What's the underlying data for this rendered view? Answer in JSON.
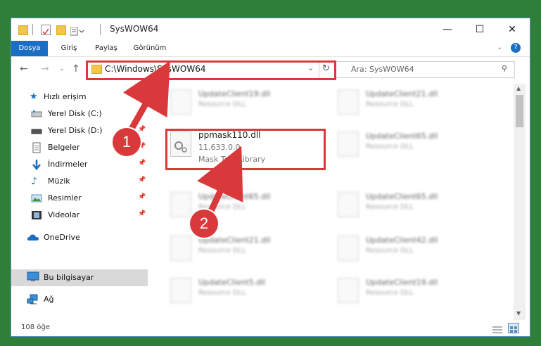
{
  "window": {
    "title": "SysWOW64"
  },
  "ribbon": {
    "tabs": [
      "Dosya",
      "Giriş",
      "Paylaş",
      "Görünüm"
    ]
  },
  "address": {
    "path": "C:\\Windows\\SysWOW64",
    "search_placeholder": "Ara: SysWOW64"
  },
  "sidebar": {
    "items": [
      {
        "label": "Hızlı erişim",
        "icon": "star-icon",
        "pinned": false
      },
      {
        "label": "Yerel Disk (C:)",
        "icon": "drive-icon",
        "pinned": false
      },
      {
        "label": "Yerel Disk (D:)",
        "icon": "drive-icon",
        "pinned": true
      },
      {
        "label": "Belgeler",
        "icon": "documents-icon",
        "pinned": true
      },
      {
        "label": "İndirmeler",
        "icon": "download-icon",
        "pinned": true
      },
      {
        "label": "Müzik",
        "icon": "music-icon",
        "pinned": true
      },
      {
        "label": "Resimler",
        "icon": "pictures-icon",
        "pinned": true
      },
      {
        "label": "Videolar",
        "icon": "videos-icon",
        "pinned": true
      },
      {
        "label": "OneDrive",
        "icon": "cloud-icon",
        "pinned": false
      },
      {
        "label": "Bu bilgisayar",
        "icon": "computer-icon",
        "pinned": false
      },
      {
        "label": "Ağ",
        "icon": "network-icon",
        "pinned": false
      }
    ]
  },
  "files": {
    "left": [
      {
        "name": "UpdateClient19.dll",
        "type": "Resource DLL"
      },
      {
        "name": "ppmask110.dll",
        "version": "11.633.0.0",
        "type": "Mask Tool Library"
      },
      {
        "name": "UpdateClient65.dll",
        "type": "Resource DLL"
      },
      {
        "name": "UpdateClient21.dll",
        "type": "Resource DLL"
      },
      {
        "name": "UpdateClient5.dll",
        "type": "Resource DLL"
      }
    ],
    "right": [
      {
        "name": "UpdateClient21.dll",
        "type": "Resource DLL"
      },
      {
        "name": "UpdateClient65.dll",
        "type": "Resource DLL"
      },
      {
        "name": "UpdateClient65.dll",
        "type": "Resource DLL"
      },
      {
        "name": "UpdateClient42.dll",
        "type": "Resource DLL"
      },
      {
        "name": "UpdateClient19.dll",
        "type": "Resource DLL"
      }
    ]
  },
  "status": {
    "count": "108 öğe"
  },
  "annotations": {
    "step1": "1",
    "step2": "2",
    "color": "#d9393a"
  }
}
